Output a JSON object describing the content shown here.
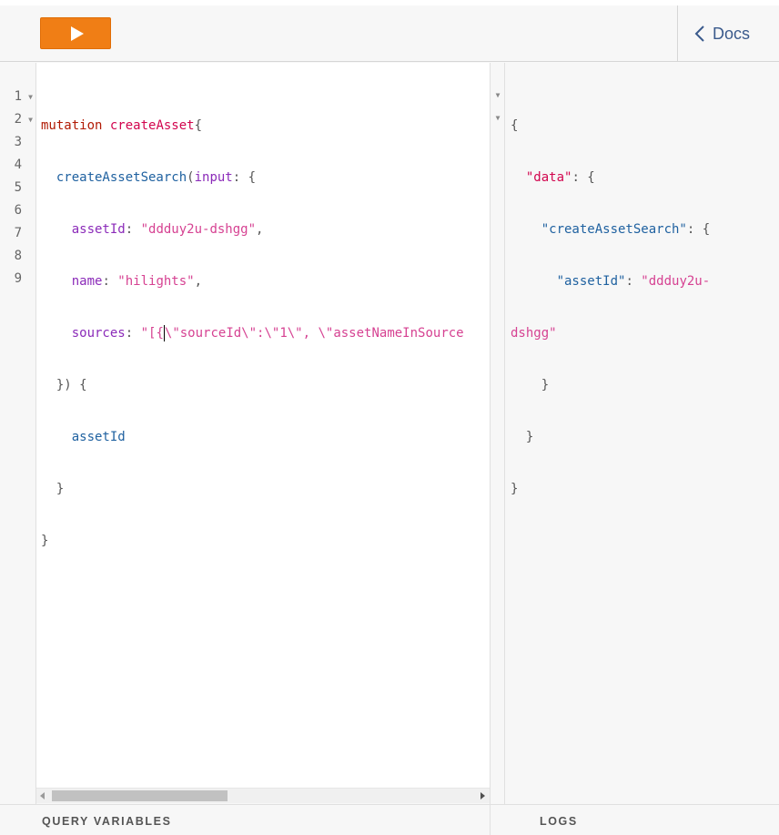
{
  "toolbar": {
    "run_icon": "play-icon",
    "docs_icon": "chevron-left-icon",
    "docs_label": "Docs"
  },
  "editor": {
    "line_numbers": [
      "1",
      "2",
      "3",
      "4",
      "5",
      "6",
      "7",
      "8",
      "9"
    ],
    "tokens": {
      "l1_kw": "mutation",
      "l1_name": "createAsset",
      "l1_brace": "{",
      "l2_fn": "createAssetSearch",
      "l2_open": "(",
      "l2_arg": "input",
      "l2_rest": ": {",
      "l3_key": "assetId",
      "l3_colon": ": ",
      "l3_val": "\"ddduy2u-dshgg\"",
      "l3_comma": ",",
      "l4_key": "name",
      "l4_colon": ": ",
      "l4_val": "\"hilights\"",
      "l4_comma": ",",
      "l5_key": "sources",
      "l5_colon": ": ",
      "l5_val_a": "\"[{",
      "l5_val_b": "\\\"sourceId\\\":\\\"1\\\", \\\"assetNameInSource",
      "l6": "}) {",
      "l7": "assetId",
      "l8": "}",
      "l9": "}"
    }
  },
  "result": {
    "l1": "{",
    "l2_key": "\"data\"",
    "l2_rest": ": {",
    "l3_key": "\"createAssetSearch\"",
    "l3_rest": ": {",
    "l4_key": "\"assetId\"",
    "l4_colon": ": ",
    "l4_val": "\"ddduy2u-",
    "l5_val": "dshgg\"",
    "l6": "}",
    "l7": "}",
    "l8": "}"
  },
  "bottom": {
    "query_variables_label": "QUERY VARIABLES",
    "logs_label": "LOGS"
  }
}
